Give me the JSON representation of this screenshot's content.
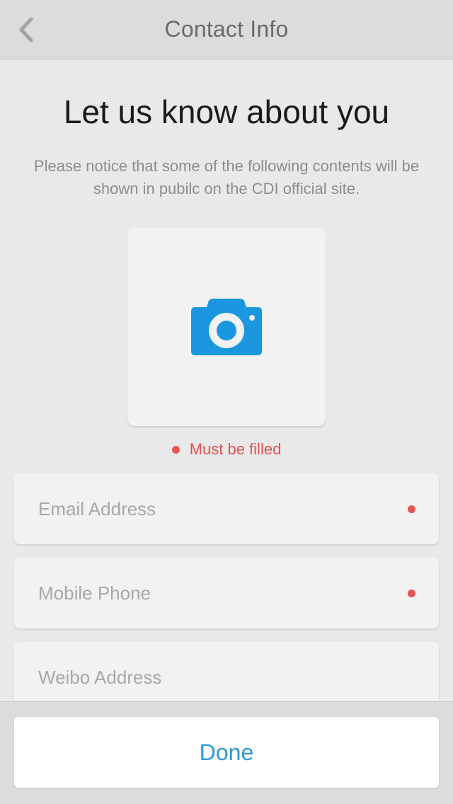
{
  "navbar": {
    "title": "Contact Info",
    "back_icon": "chevron-left-icon"
  },
  "main": {
    "heading": "Let us know about you",
    "notice": "Please notice that some of the following contents will be shown in pubilc on the CDI official site.",
    "photo_icon": "camera-icon",
    "required_note": "Must be filled"
  },
  "fields": [
    {
      "placeholder": "Email Address",
      "value": "",
      "required": true
    },
    {
      "placeholder": "Mobile Phone",
      "value": "",
      "required": true
    },
    {
      "placeholder": "Weibo Address",
      "value": "",
      "required": false
    }
  ],
  "footer": {
    "done_label": "Done"
  },
  "colors": {
    "accent": "#2a9ad8",
    "camera": "#1a97de",
    "required": "#e85454"
  }
}
